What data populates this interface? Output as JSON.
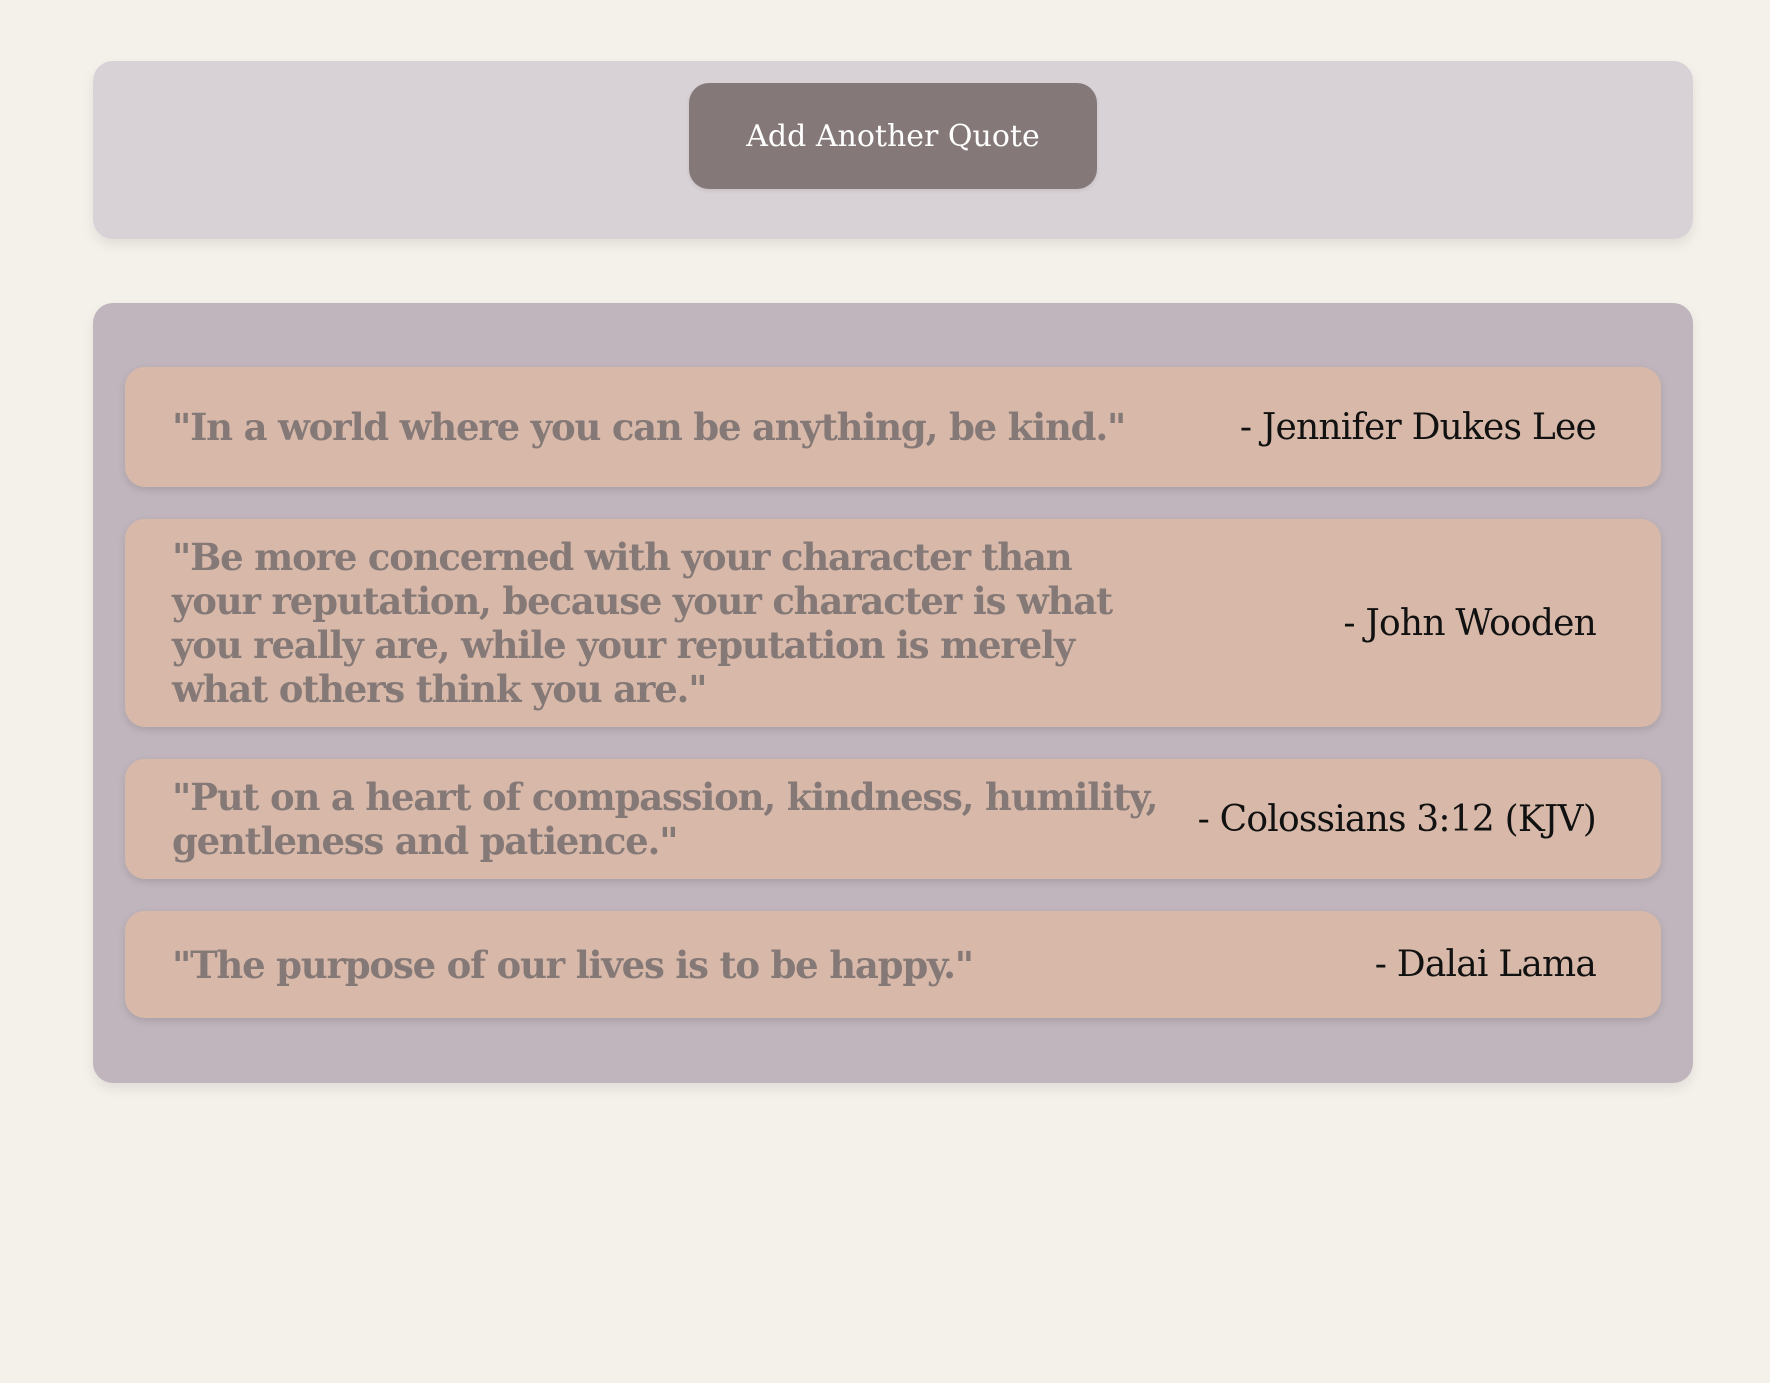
{
  "toolbar": {
    "add_button_label": "Add Another Quote"
  },
  "quotes": [
    {
      "text": "\"In a world where you can be anything, be kind.\"",
      "author": "- Jennifer Dukes Lee"
    },
    {
      "text": "\"Be more concerned with your character than your reputation, because your character is what you really are, while your reputation is merely what others think you are.\"",
      "author": "- John Wooden"
    },
    {
      "text": "\"Put on a heart of compassion, kindness, humility, gentleness and patience.\"",
      "author": "- Colossians 3:12 (KJV)"
    },
    {
      "text": "\"The purpose of our lives is to be happy.\"",
      "author": "- Dalai Lama"
    }
  ],
  "colors": {
    "page_background": "#f4f0ea",
    "toolbar_background": "#d8d2d6",
    "button_background": "#847978",
    "panel_background": "#c0b5bd",
    "card_background": "#d8b9a9",
    "quote_text": "#857977",
    "author_text": "#111111"
  }
}
